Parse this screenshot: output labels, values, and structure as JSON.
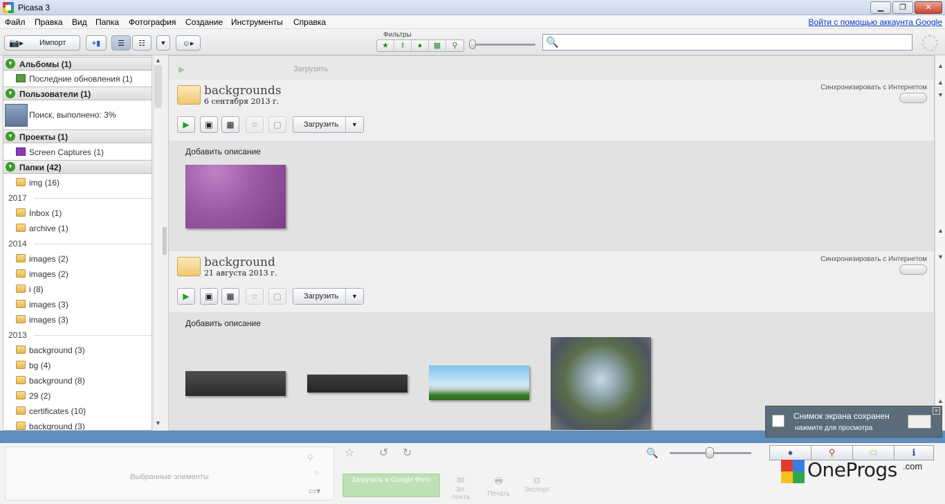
{
  "window": {
    "title": "Picasa 3",
    "buttons": {
      "minimize": "▁",
      "maximize": "❐",
      "close": "✕"
    }
  },
  "menu": {
    "items": [
      "Файл",
      "Правка",
      "Вид",
      "Папка",
      "Фотография",
      "Создание",
      "Инструменты",
      "Справка"
    ],
    "signin": "Войти с помощью аккаунта Google"
  },
  "toolbar": {
    "import_label": "Импорт",
    "filters_label": "Фильтры"
  },
  "left_panel": {
    "albums": {
      "label": "Альбомы (1)",
      "items": [
        "Последние обновления (1)"
      ]
    },
    "people": {
      "label": "Пользователи (1)",
      "search_status": "Поиск, выполнено: 3%"
    },
    "projects": {
      "label": "Проекты (1)",
      "items": [
        "Screen Captures (1)"
      ]
    },
    "folders": {
      "label": "Папки (42)",
      "top": [
        "img (16)"
      ],
      "years": [
        {
          "year": "2017",
          "items": [
            "Inbox (1)",
            "archive (1)"
          ]
        },
        {
          "year": "2014",
          "items": [
            "images (2)",
            "images (2)",
            "i (8)",
            "images (3)",
            "images (3)"
          ]
        },
        {
          "year": "2013",
          "items": [
            "background (3)",
            "bg (4)",
            "background (8)",
            "29 (2)",
            "certificates (10)",
            "background (3)"
          ]
        }
      ]
    }
  },
  "main": {
    "ghost_upload": "Загрузить",
    "albums": [
      {
        "title": "backgrounds",
        "date": "6 сентября 2013 г.",
        "sync": "Синхронизировать с Интернетом",
        "upload": "Загрузить",
        "add_description": "Добавить описание"
      },
      {
        "title": "background",
        "date": "21 августа 2013 г.",
        "sync": "Синхронизировать с Интернетом",
        "upload": "Загрузить",
        "add_description": "Добавить описание"
      }
    ]
  },
  "bottom": {
    "selected_label": "Выбранные элементы",
    "upload_google": "Загрузить в Google Фото",
    "actions": [
      {
        "icon": "✉",
        "label": "Эл. почта"
      },
      {
        "icon": "🖶",
        "label": "Печать"
      },
      {
        "icon": "⧉",
        "label": "Экспорт"
      }
    ]
  },
  "toast": {
    "title": "Снимок экрана сохранен",
    "subtitle": "нажмите для просмотра"
  },
  "watermark": {
    "word": "OneProgs",
    "suffix": ".com"
  },
  "colors": {
    "accent_blue": "#5e8fbc",
    "green": "#3d9b2c",
    "link": "#0b38c4"
  }
}
